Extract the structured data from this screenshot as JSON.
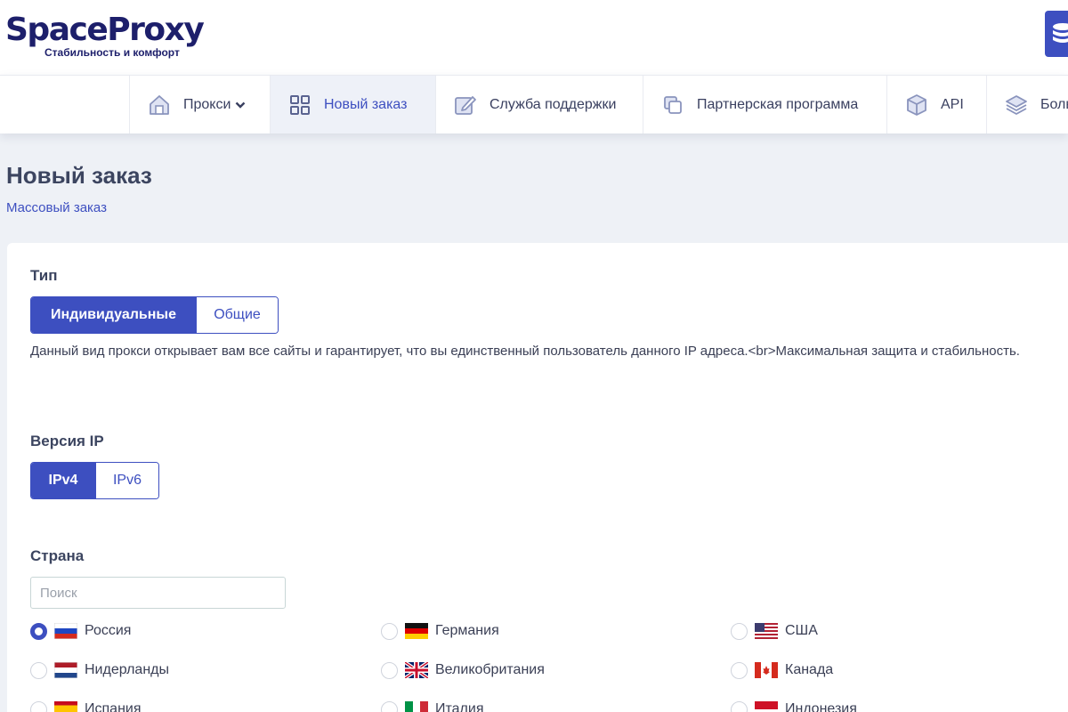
{
  "brand": {
    "name": "SpaceProxy",
    "tagline": "Стабильность и комфорт"
  },
  "nav": {
    "items": [
      {
        "label": "Прокси",
        "icon": "home-icon"
      },
      {
        "label": "Новый заказ",
        "icon": "grid-icon"
      },
      {
        "label": "Служба поддержки",
        "icon": "edit-icon"
      },
      {
        "label": "Партнерская программа",
        "icon": "copy-icon"
      },
      {
        "label": "API",
        "icon": "cube-icon"
      },
      {
        "label": "Боль",
        "icon": "layers-icon"
      }
    ]
  },
  "page": {
    "title": "Новый заказ",
    "breadcrumb": "Массовый заказ"
  },
  "type_section": {
    "label": "Тип",
    "options": [
      "Индивидуальные",
      "Общие"
    ],
    "selected": "Индивидуальные",
    "description": "Данный вид прокси открывает вам все сайты и гарантирует, что вы единственный пользователь данного IP адреса.<br>Максимальная защита и стабильность."
  },
  "ip_section": {
    "label": "Версия IP",
    "options": [
      "IPv4",
      "IPv6"
    ],
    "selected": "IPv4"
  },
  "country_section": {
    "label": "Страна",
    "search_placeholder": "Поиск",
    "countries": [
      {
        "name": "Россия",
        "selected": true
      },
      {
        "name": "Германия",
        "selected": false
      },
      {
        "name": "США",
        "selected": false
      },
      {
        "name": "Нидерланды",
        "selected": false
      },
      {
        "name": "Великобритания",
        "selected": false
      },
      {
        "name": "Канада",
        "selected": false
      },
      {
        "name": "Испания",
        "selected": false
      },
      {
        "name": "Италия",
        "selected": false
      },
      {
        "name": "Индонезия",
        "selected": false
      }
    ]
  },
  "colors": {
    "accent": "#3d4fc0",
    "brand": "#1d1f6b",
    "nav_active_bg": "#eef1f8"
  }
}
